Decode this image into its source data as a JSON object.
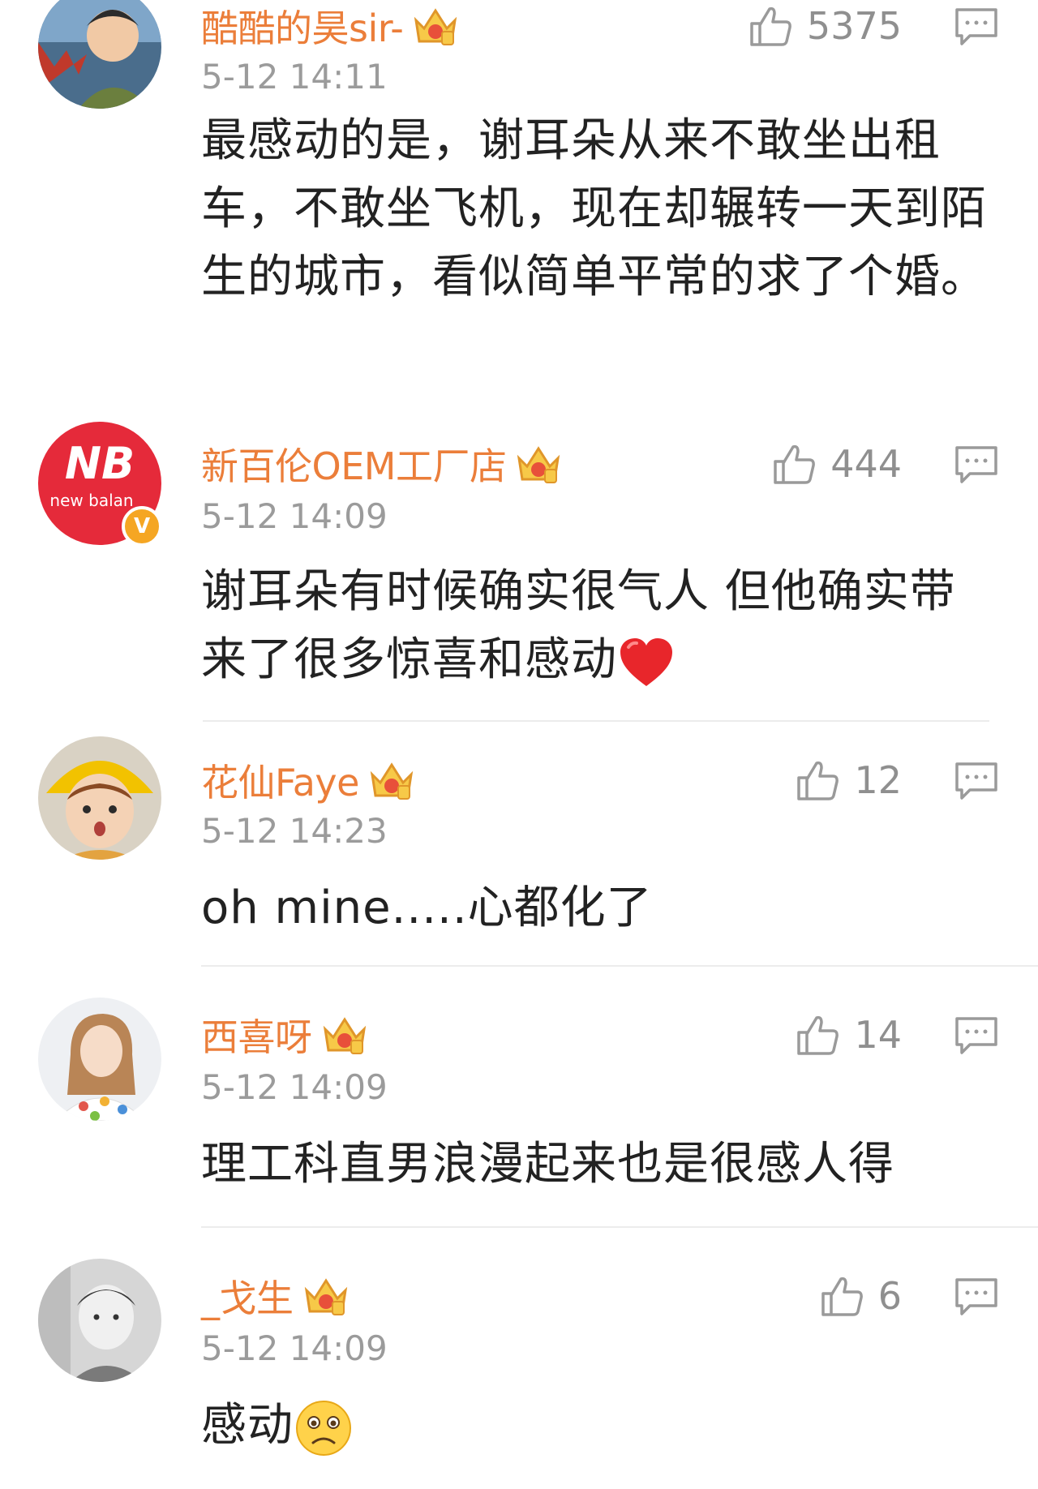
{
  "colors": {
    "username": "#eb7e3a",
    "meta": "#9b9b9b",
    "text": "#222222",
    "divider": "#ececec"
  },
  "comments": [
    {
      "username": "酷酷的昊sir-",
      "time": "5-12 14:11",
      "likes": "5375",
      "content": "最感动的是，谢耳朵从来不敢坐出租车，不敢坐飞机，现在却辗转一天到陌生的城市，看似简单平常的求了个婚。",
      "avatar": "avatar-boy-icon"
    },
    {
      "username": "新百伦OEM工厂店",
      "time": "5-12 14:09",
      "likes": "444",
      "content": "谢耳朵有时候确实很气人 但他确实带来了很多惊喜和感动",
      "avatar": "new-balance-logo-icon",
      "avatar_text": "new balan",
      "verified": "V"
    },
    {
      "username": "花仙Faye",
      "time": "5-12 14:23",
      "likes": "12",
      "content": "oh mine.....心都化了",
      "avatar": "avatar-girl-yellow-hat-icon"
    },
    {
      "username": "西喜呀",
      "time": "5-12 14:09",
      "likes": "14",
      "content": "理工科直男浪漫起来也是很感人得",
      "avatar": "avatar-girl-icon"
    },
    {
      "username": "_戈生",
      "time": "5-12 14:09",
      "likes": "6",
      "content": "感动",
      "avatar": "avatar-man-bw-icon"
    }
  ]
}
